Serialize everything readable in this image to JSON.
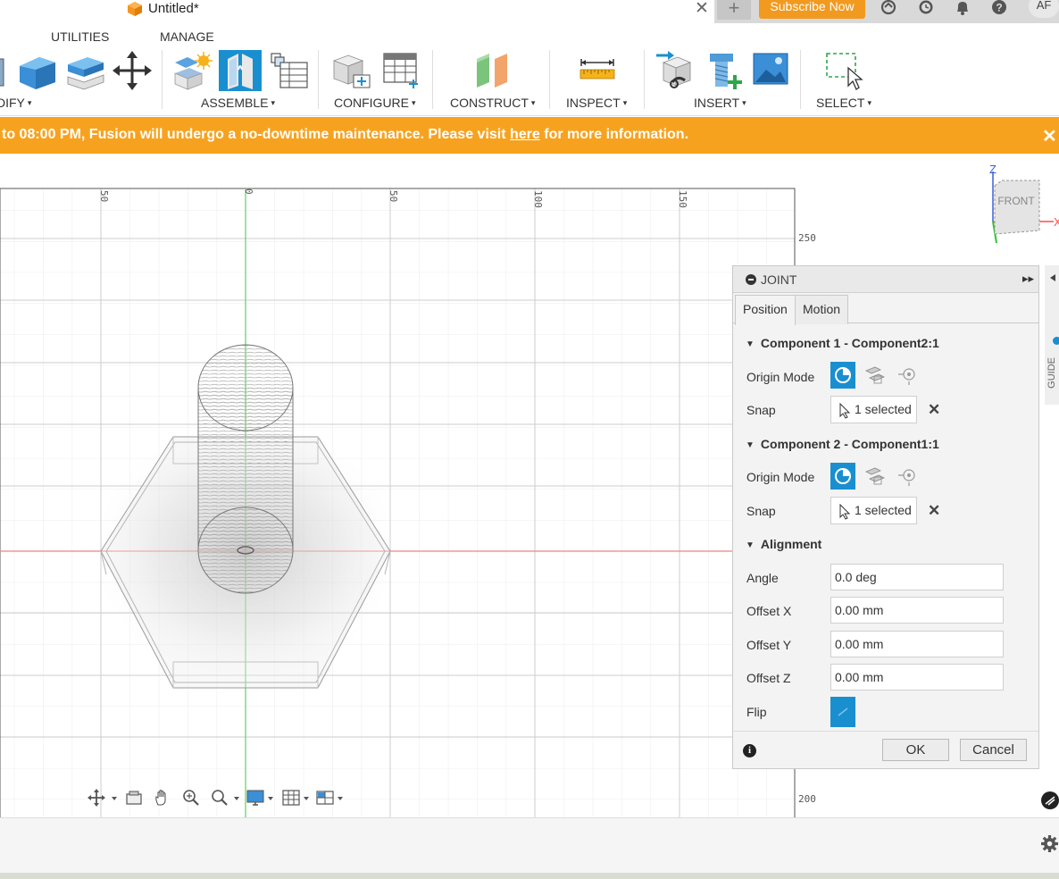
{
  "titlebar": {
    "document_title": "Untitled*",
    "subscribe_label": "Subscribe Now",
    "avatar_initials": "AF",
    "add_tab_label": "+"
  },
  "toolbar": {
    "tabs": [
      "UTILITIES",
      "MANAGE"
    ],
    "groups": {
      "modify": "DIFY",
      "assemble": "ASSEMBLE",
      "configure": "CONFIGURE",
      "construct": "CONSTRUCT",
      "inspect": "INSPECT",
      "insert": "INSERT",
      "select": "SELECT"
    },
    "caret": "▾"
  },
  "banner": {
    "text_before": "to 08:00 PM, Fusion will undergo a no-downtime maintenance. Please visit ",
    "link": "here",
    "text_after": " for more information.",
    "close": "✕"
  },
  "viewport": {
    "ruler_top_labels": [
      "50",
      "0",
      "50",
      "100",
      "150"
    ],
    "ruler_right_labels": [
      "250",
      "200"
    ],
    "viewcube": {
      "face": "FRONT",
      "axis_z": "Z",
      "axis_x": "X"
    }
  },
  "joint_panel": {
    "title": "JOINT",
    "tabs": [
      "Position",
      "Motion"
    ],
    "active_tab": "Position",
    "component1": {
      "header": "Component 1 - Component2:1",
      "origin_mode_label": "Origin Mode",
      "snap_label": "Snap",
      "snap_value": "1 selected"
    },
    "component2": {
      "header": "Component 2 - Component1:1",
      "origin_mode_label": "Origin Mode",
      "snap_label": "Snap",
      "snap_value": "1 selected"
    },
    "alignment": {
      "header": "Alignment",
      "angle_label": "Angle",
      "angle_value": "0.0 deg",
      "offset_x_label": "Offset X",
      "offset_x_value": "0.00 mm",
      "offset_y_label": "Offset Y",
      "offset_y_value": "0.00 mm",
      "offset_z_label": "Offset Z",
      "offset_z_value": "0.00 mm",
      "flip_label": "Flip"
    },
    "ok_label": "OK",
    "cancel_label": "Cancel",
    "info": "i"
  },
  "side": {
    "guide_label": "GUIDE"
  },
  "colors": {
    "accent_blue": "#1a8fd0",
    "banner_orange": "#f7a21f",
    "subscribe_orange": "#f29a1f",
    "axis_green": "#5fd35f",
    "axis_red": "#f08080"
  }
}
